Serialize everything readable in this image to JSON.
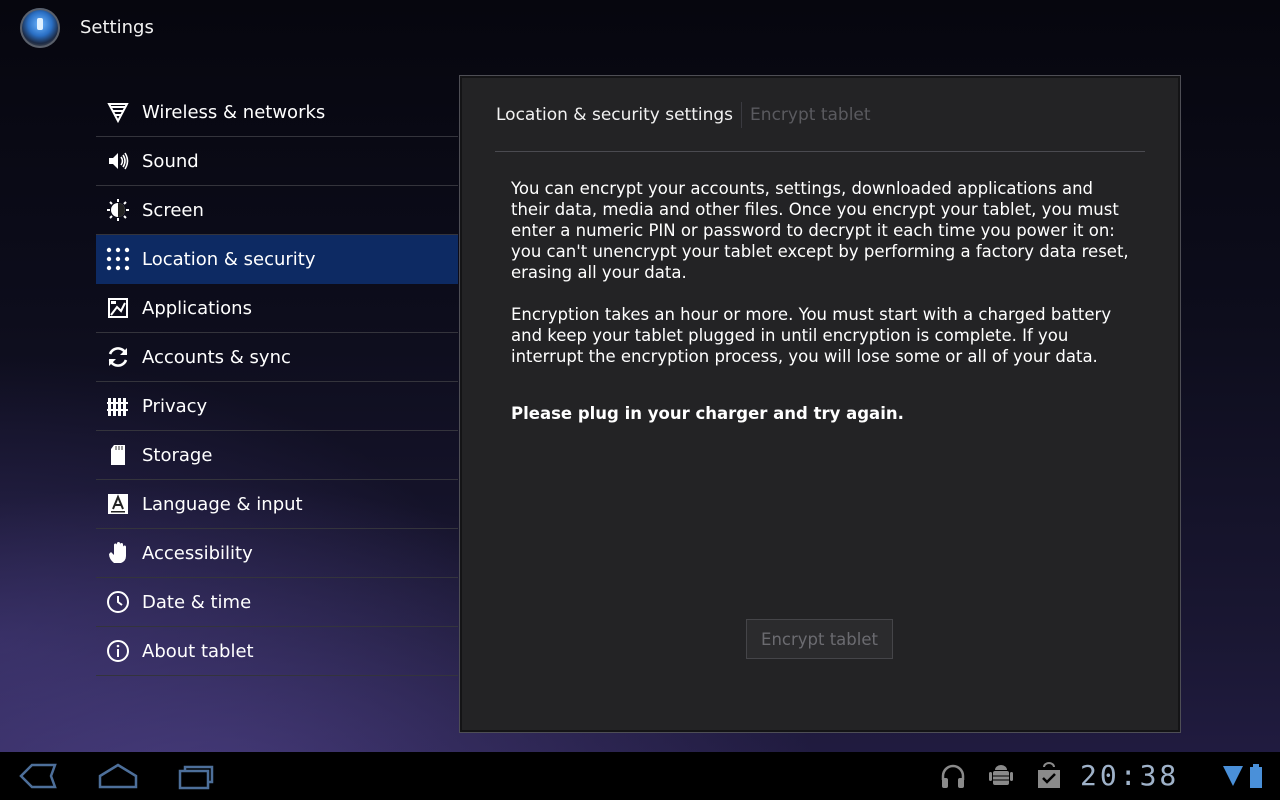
{
  "app": {
    "title": "Settings",
    "icon": "settings-app-icon"
  },
  "sidebar": {
    "items": [
      {
        "label": "Wireless & networks",
        "icon": "wifi-icon",
        "selected": false
      },
      {
        "label": "Sound",
        "icon": "speaker-icon",
        "selected": false
      },
      {
        "label": "Screen",
        "icon": "brightness-icon",
        "selected": false
      },
      {
        "label": "Location & security",
        "icon": "pattern-lock-icon",
        "selected": true
      },
      {
        "label": "Applications",
        "icon": "applications-icon",
        "selected": false
      },
      {
        "label": "Accounts & sync",
        "icon": "sync-icon",
        "selected": false
      },
      {
        "label": "Privacy",
        "icon": "privacy-fence-icon",
        "selected": false
      },
      {
        "label": "Storage",
        "icon": "sd-card-icon",
        "selected": false
      },
      {
        "label": "Language & input",
        "icon": "language-icon",
        "selected": false
      },
      {
        "label": "Accessibility",
        "icon": "hand-icon",
        "selected": false
      },
      {
        "label": "Date & time",
        "icon": "clock-icon",
        "selected": false
      },
      {
        "label": "About tablet",
        "icon": "info-icon",
        "selected": false
      }
    ]
  },
  "content": {
    "breadcrumb": [
      "Location & security settings",
      "Encrypt tablet"
    ],
    "paragraphs": [
      "You can encrypt your accounts, settings, downloaded applications and their data, media and other files. Once you encrypt your tablet, you must enter a numeric PIN or password to decrypt it each time you power it on: you can't unencrypt your tablet except by performing a factory data reset, erasing all your data.",
      "Encryption takes an hour or more. You must start with a charged battery and keep your tablet plugged in until encryption is complete. If you interrupt the encryption process, you will lose some or all of your data.",
      "Please plug in your charger and try again."
    ],
    "encrypt_button": {
      "label": "Encrypt tablet",
      "enabled": false
    }
  },
  "system_bar": {
    "nav": [
      "back-icon",
      "home-icon",
      "recent-apps-icon"
    ],
    "status_icons": [
      "headphones-icon",
      "usb-debugging-icon",
      "download-complete-icon"
    ],
    "clock": "20:38",
    "signal_icon": "signal-icon",
    "battery_icon": "battery-icon"
  },
  "colors": {
    "selected_bg": "#0d2a63",
    "panel_bg": "#232325",
    "clock_color": "#9fb2c9",
    "disabled_text": "#6b6b70"
  }
}
